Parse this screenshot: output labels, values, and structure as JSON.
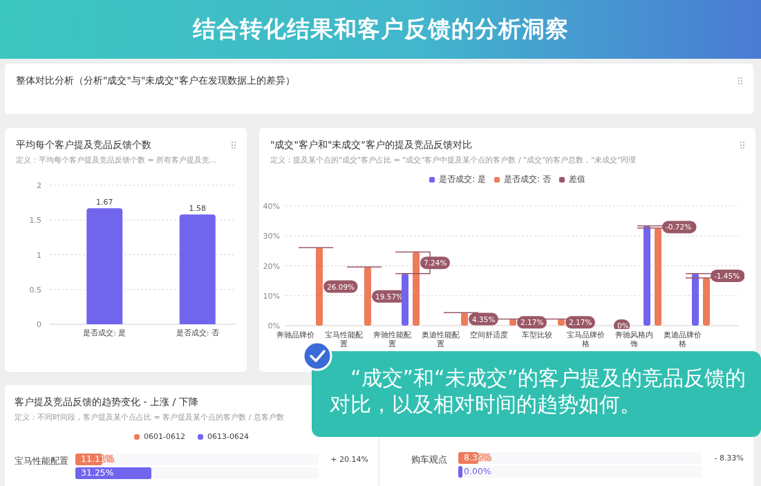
{
  "banner": {
    "title": "结合转化结果和客户反馈的分析洞察"
  },
  "overview_card": {
    "title": "整体对比分析（分析\"成交\"与\"未成交\"客户在发现数据上的差异）"
  },
  "avg_card": {
    "title": "平均每个客户提及竞品反馈个数",
    "definition": "定义：平均每个客户提及竞品反馈个数 = 所有客户提及竞...",
    "chart_data": {
      "type": "bar",
      "categories": [
        "是否成交: 是",
        "是否成交: 否"
      ],
      "values": [
        1.67,
        1.58
      ],
      "ylim": [
        0,
        2
      ],
      "yticks": [
        0,
        0.5,
        1,
        1.5,
        2
      ],
      "grid": true,
      "data_labels": true
    }
  },
  "compare_card": {
    "title": "\"成交\"客户和\"未成交\"客户的提及竞品反馈对比",
    "definition": "定义：提及某个点的\"成交\"客户占比 = \"成交\"客户中提及某个点的客户数 / \"成交\"的客户总数，\"未成交\"同理",
    "chart_data": {
      "type": "bar",
      "categories": [
        "奔驰品牌价",
        "宝马性能配置",
        "奔驰性能配置",
        "奥迪性能配置",
        "空间舒适度",
        "车型比较",
        "宝马品牌价格",
        "奔驰风格内饰",
        "奥迪品牌价格"
      ],
      "series": [
        {
          "name": "是否成交: 是",
          "color": "#7165ee",
          "values": [
            0,
            0,
            17.39,
            0,
            0,
            0,
            0,
            33.33,
            17.39
          ]
        },
        {
          "name": "是否成交: 否",
          "color": "#ee7b5b",
          "values": [
            26.09,
            19.57,
            24.63,
            4.35,
            2.17,
            2.17,
            0,
            32.61,
            15.94
          ]
        },
        {
          "name": "差值",
          "color": "#9a5867",
          "values": [
            null,
            null,
            null,
            null,
            null,
            null,
            null,
            null,
            null
          ]
        }
      ],
      "grid": true,
      "legend": "top",
      "ylim": [
        0,
        40
      ],
      "yticks": [
        {
          "value": 0,
          "label": "0%"
        },
        {
          "value": 10,
          "label": "10%"
        },
        {
          "value": 20,
          "label": "20%"
        },
        {
          "value": 30,
          "label": "30%"
        },
        {
          "value": 40,
          "label": "40%"
        }
      ],
      "annotations": [
        "26.09%",
        "19.57%",
        "7.24%",
        "4.35%",
        "2.17%",
        "2.17%",
        "0%",
        "-0.72%",
        "-1.45%"
      ]
    }
  },
  "trend_card": {
    "title": "客户提及竞品反馈的趋势变化 - 上涨 / 下降",
    "definition": "定义：不同时间段，客户提及某个点占比 = 客户提及某个点的客户数 / 总客户数",
    "legend": [
      {
        "label": "0601-0612",
        "color": "#ee7b5b"
      },
      {
        "label": "0613-0624",
        "color": "#7165ee"
      }
    ],
    "rows": [
      {
        "label": "宝马性能配置",
        "bars": [
          {
            "text": "11.11%",
            "level": 0.1111,
            "color": "#ee7b5b"
          },
          {
            "text": "31.25%",
            "level": 0.3125,
            "color": "#7165ee"
          }
        ],
        "change": "+ 20.14%"
      }
    ]
  },
  "trend_card_right": {
    "rows": [
      {
        "label": "购车观点",
        "bars": [
          {
            "text": "8.33%",
            "level": 0.0833,
            "color": "#ee7b5b"
          },
          {
            "text": "0.00%",
            "level": 0,
            "color": "#7165ee"
          }
        ],
        "change": "- 8.33%"
      }
    ]
  },
  "callout": {
    "text": "“成交”和“未成交”的客户提及的竞品反馈的对比，以及相对时间的趋势如何。"
  }
}
